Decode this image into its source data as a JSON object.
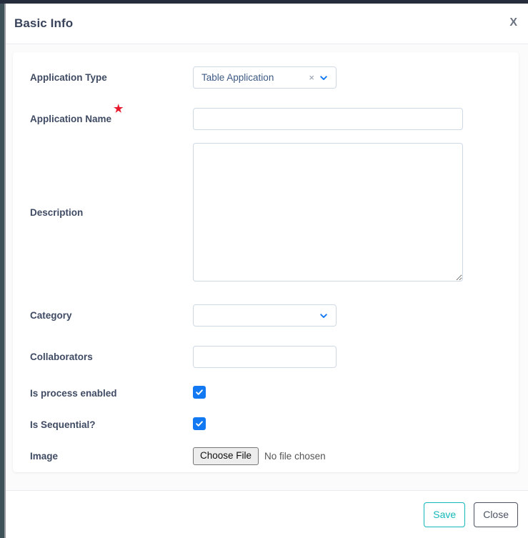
{
  "modal": {
    "title": "Basic Info",
    "close_label": "X"
  },
  "form": {
    "application_type": {
      "label": "Application Type",
      "value": "Table Application",
      "clear_label": "×",
      "required": false
    },
    "application_name": {
      "label": "Application Name",
      "value": "",
      "placeholder": "",
      "required": true,
      "required_marker": "★"
    },
    "description": {
      "label": "Description",
      "value": "",
      "placeholder": "",
      "required": false
    },
    "category": {
      "label": "Category",
      "value": "",
      "required": false
    },
    "collaborators": {
      "label": "Collaborators",
      "value": "",
      "placeholder": "",
      "required": false
    },
    "is_process_enabled": {
      "label": "Is process enabled",
      "checked": true
    },
    "is_sequential": {
      "label": "Is Sequential?",
      "checked": true
    },
    "image": {
      "label": "Image",
      "button_label": "Choose File",
      "file_status": "No file chosen"
    }
  },
  "footer": {
    "save_label": "Save",
    "close_label": "Close"
  },
  "colors": {
    "accent_blue": "#1279f2",
    "save_teal": "#12b8ba",
    "close_gray": "#4c5363",
    "required_red": "#e8192c",
    "label_text": "#3f4a63",
    "title_text": "#39435c",
    "input_border": "#cfd9e6",
    "topbar": "#262d3d",
    "rail": "#3f5159"
  }
}
